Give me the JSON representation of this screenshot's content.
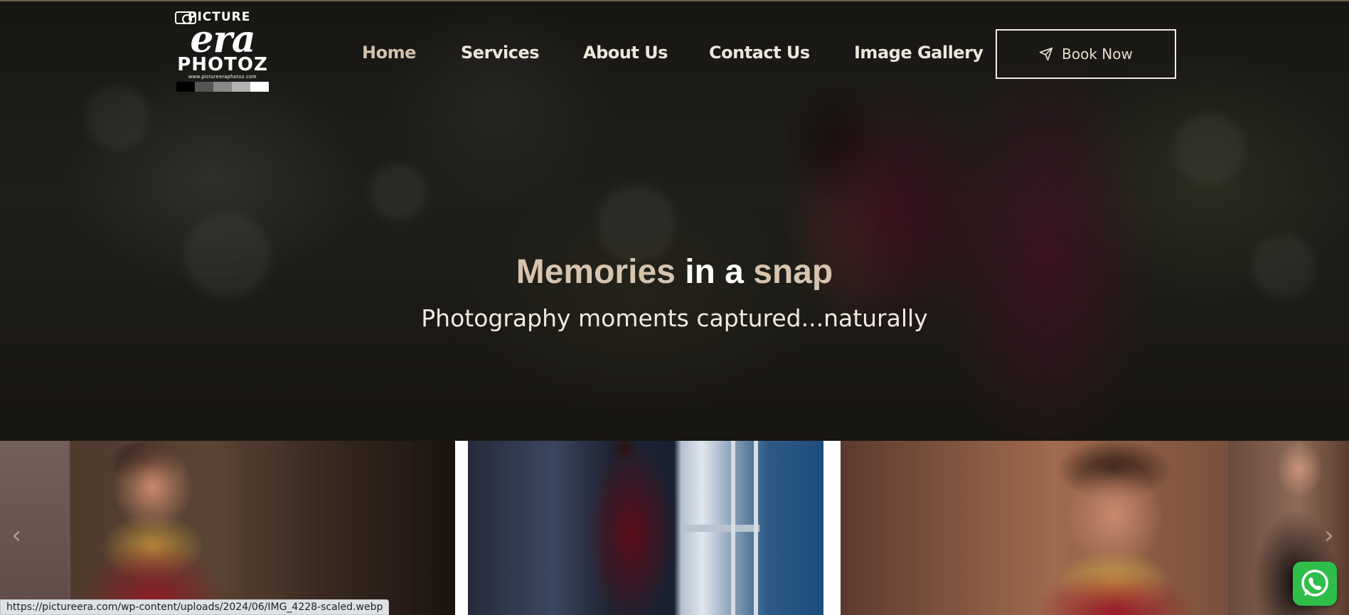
{
  "brand": {
    "logo_line1": "PICTURE",
    "logo_line2": "era",
    "logo_line3": "PHOTOZ",
    "logo_url": "www.pictureeraphotoz.com",
    "swatch_colors": [
      "#000000",
      "#555555",
      "#888888",
      "#b3b3b3",
      "#ffffff"
    ]
  },
  "nav": {
    "items": [
      {
        "label": "Home",
        "active": true
      },
      {
        "label": "Services",
        "active": false
      },
      {
        "label": "About Us",
        "active": false
      },
      {
        "label": "Contact Us",
        "active": false
      },
      {
        "label": "Image Gallery",
        "active": false
      }
    ],
    "cta": {
      "label": "Book Now",
      "icon": "paper-plane-icon"
    }
  },
  "hero": {
    "title_word1": "Memories",
    "title_word2": "in a",
    "title_word3": "snap",
    "subtitle": "Photography moments captured...naturally"
  },
  "gallery": {
    "prev_icon": "chevron-left-icon",
    "next_icon": "chevron-right-icon",
    "prev_glyph": "‹",
    "next_glyph": "›"
  },
  "whatsapp": {
    "icon": "whatsapp-icon"
  },
  "status_bar": {
    "url": "https://pictureera.com/wp-content/uploads/2024/06/IMG_4228-scaled.webp"
  },
  "colors": {
    "accent": "#d6c4ae",
    "nav_text": "#ece6dc",
    "whatsapp": "#2fbe4a"
  }
}
